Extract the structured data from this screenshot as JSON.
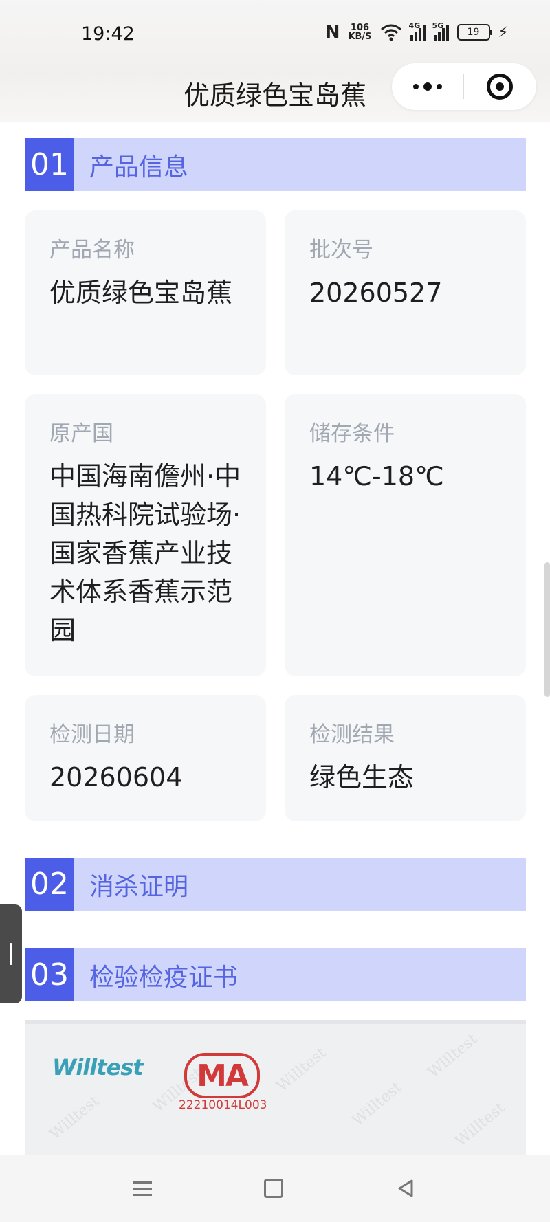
{
  "status_bar": {
    "time": "19:42",
    "network_speed_value": "106",
    "network_speed_unit": "KB/S",
    "signal_1": "4G",
    "signal_2": "5G",
    "battery": "19"
  },
  "nav": {
    "title": "优质绿色宝岛蕉"
  },
  "sections": [
    {
      "num": "01",
      "title": "产品信息"
    },
    {
      "num": "02",
      "title": "消杀证明"
    },
    {
      "num": "03",
      "title": "检验检疫证书"
    }
  ],
  "info_cards": [
    {
      "label": "产品名称",
      "value": "优质绿色宝岛蕉"
    },
    {
      "label": "批次号",
      "value": "20260527"
    },
    {
      "label": "原产国",
      "value": "中国海南儋州·中国热科院试验场·国家香蕉产业技术体系香蕉示范园"
    },
    {
      "label": "储存条件",
      "value": "14℃-18℃"
    },
    {
      "label": "检测日期",
      "value": "20260604"
    },
    {
      "label": "检测结果",
      "value": "绿色生态"
    }
  ],
  "certificate": {
    "logo_text": "Willtest",
    "ma_mark": "MA",
    "ma_code": "22210014L003",
    "watermark": "Willtest"
  }
}
